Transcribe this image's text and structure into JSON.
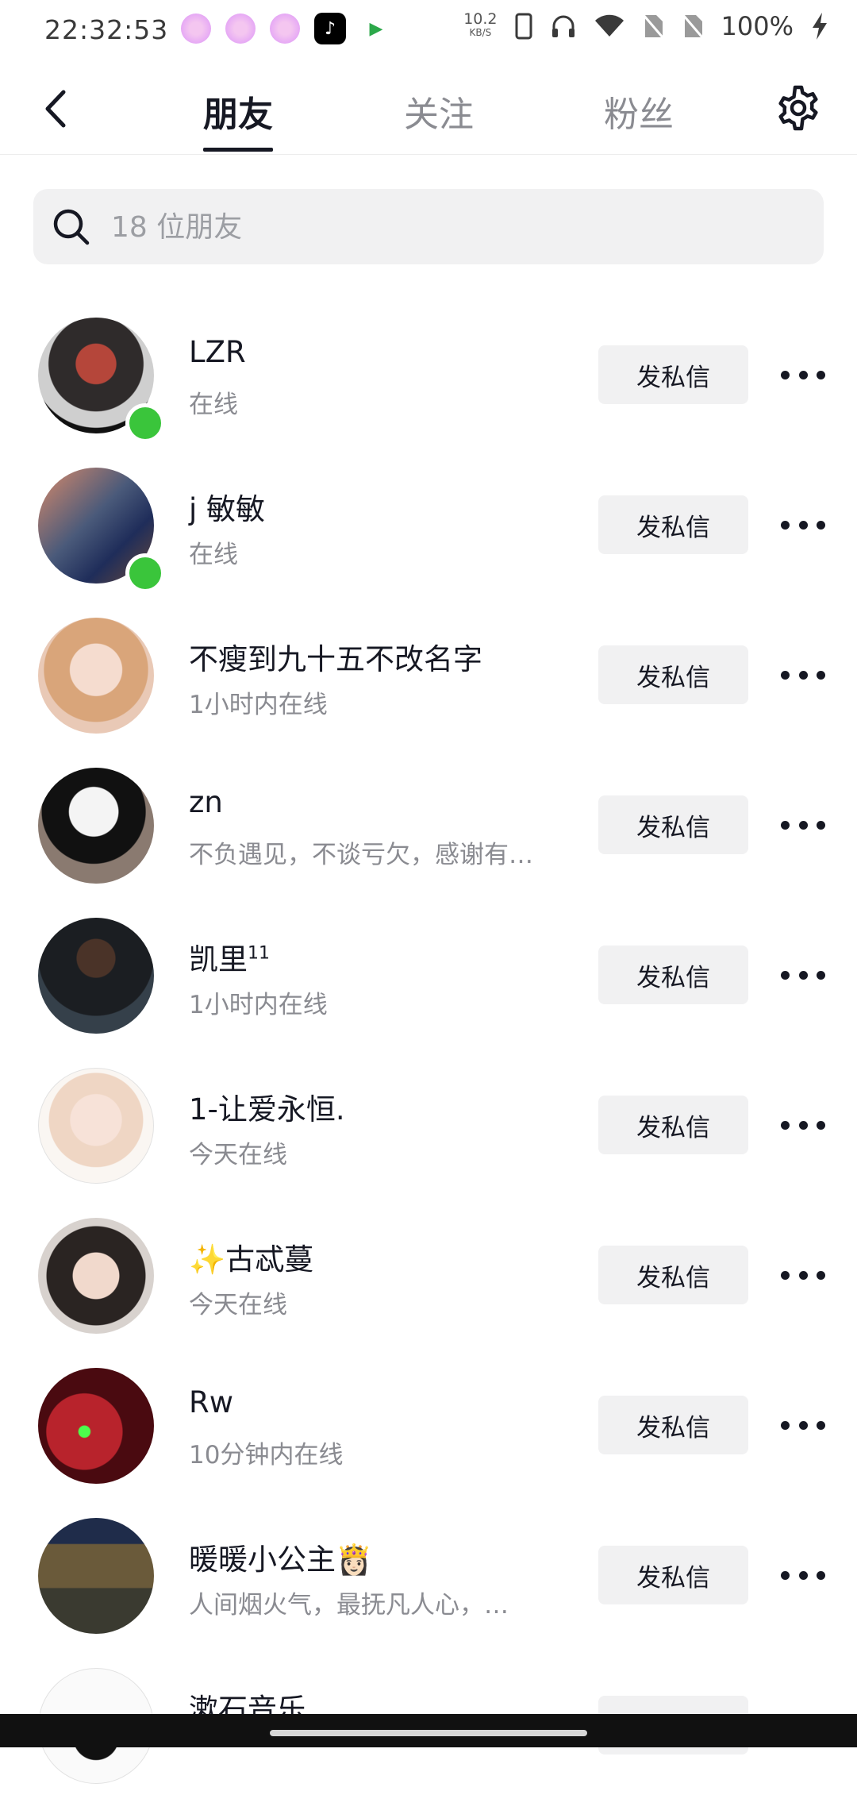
{
  "status_bar": {
    "time": "22:32:53",
    "net_speed": "10.2",
    "net_unit": "KB/S",
    "battery": "100%",
    "icons": [
      "signal-icon",
      "headphones-icon",
      "wifi-icon",
      "sim-off-icon",
      "sim-off-icon",
      "charging-icon"
    ]
  },
  "header": {
    "tabs": [
      {
        "label": "朋友",
        "active": true
      },
      {
        "label": "关注",
        "active": false
      },
      {
        "label": "粉丝",
        "active": false
      }
    ]
  },
  "search": {
    "placeholder": "18 位朋友"
  },
  "friends": [
    {
      "name": "LZR",
      "status": "在线",
      "online": true,
      "dm_label": "发私信"
    },
    {
      "name": "j 敏敏",
      "status": "在线",
      "online": true,
      "dm_label": "发私信"
    },
    {
      "name": "不瘦到九十五不改名字",
      "status": "1小时内在线",
      "online": false,
      "dm_label": "发私信"
    },
    {
      "name": "zn",
      "status": "不负遇见，不谈亏欠，感谢有…",
      "online": false,
      "dm_label": "发私信"
    },
    {
      "name": "凯里",
      "name_sup": "11",
      "status": "1小时内在线",
      "online": false,
      "dm_label": "发私信"
    },
    {
      "name": "1-让爱永恒.",
      "status": "今天在线",
      "online": false,
      "dm_label": "发私信"
    },
    {
      "name": "✨古忒蔓",
      "status": "今天在线",
      "online": false,
      "dm_label": "发私信"
    },
    {
      "name": "Rw",
      "status": "10分钟内在线",
      "online": false,
      "dm_label": "发私信"
    },
    {
      "name": "暖暖小公主👸🏻",
      "status": "人间烟火气，最抚凡人心，…",
      "online": false,
      "dm_label": "发私信"
    },
    {
      "name": "漱石音乐",
      "status": "",
      "online": false,
      "dm_label": "发私信"
    }
  ],
  "colors": {
    "online": "#3ac53b",
    "button_bg": "#f1f1f2",
    "text_primary": "#161823",
    "text_secondary": "#8a8b91"
  }
}
